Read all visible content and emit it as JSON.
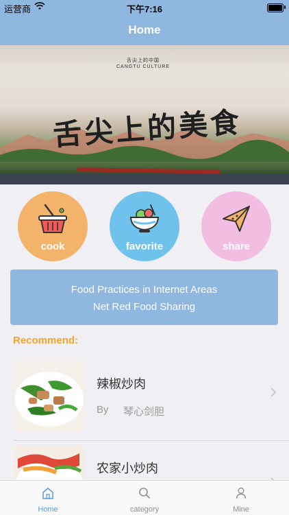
{
  "status_bar": {
    "carrier": "运营商",
    "time": "下午7:16"
  },
  "navbar": {
    "title": "Home"
  },
  "banner": {
    "brand_line1": "舌尖上的中国",
    "brand_line2": "CANGTU CULTURE",
    "title": "舌尖上的美食"
  },
  "actions": [
    {
      "label": "cook",
      "icon": "basket-icon",
      "color": "#f4b36b"
    },
    {
      "label": "favorite",
      "icon": "bowl-icon",
      "color": "#6fc2ec"
    },
    {
      "label": "share",
      "icon": "paper-plane-icon",
      "color": "#f1bde0"
    }
  ],
  "slogan": {
    "line1": "Food Practices in Internet Areas",
    "line2": "Net Red Food Sharing"
  },
  "recommend": {
    "heading": "Recommend:"
  },
  "recipes": [
    {
      "name": "辣椒炒肉",
      "by_label": "By",
      "author": "琴心剑胆"
    },
    {
      "name": "农家小炒肉",
      "by_label": "",
      "author": ""
    }
  ],
  "tabs": [
    {
      "label": "Home",
      "icon": "home-icon",
      "active": true
    },
    {
      "label": "category",
      "icon": "search-icon",
      "active": false
    },
    {
      "label": "Mine",
      "icon": "person-icon",
      "active": false
    }
  ],
  "colors": {
    "accent": "#8fb7df",
    "recommend": "#f0a52c",
    "tab_active": "#5b9bd5"
  }
}
